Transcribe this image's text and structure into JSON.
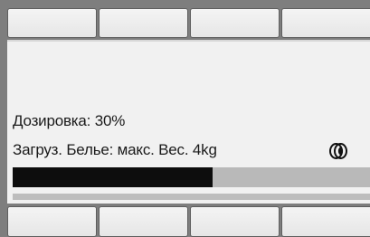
{
  "softkeys_top": [
    "",
    "",
    "",
    ""
  ],
  "softkeys_bottom": [
    "",
    "",
    "",
    ""
  ],
  "display": {
    "dosage_text": "Дозировка: 30%",
    "load_text": "Загруз. Белье: макс. Вес. 4kg",
    "status_icon": "drum-load-icon",
    "progress_fraction": 0.56
  }
}
